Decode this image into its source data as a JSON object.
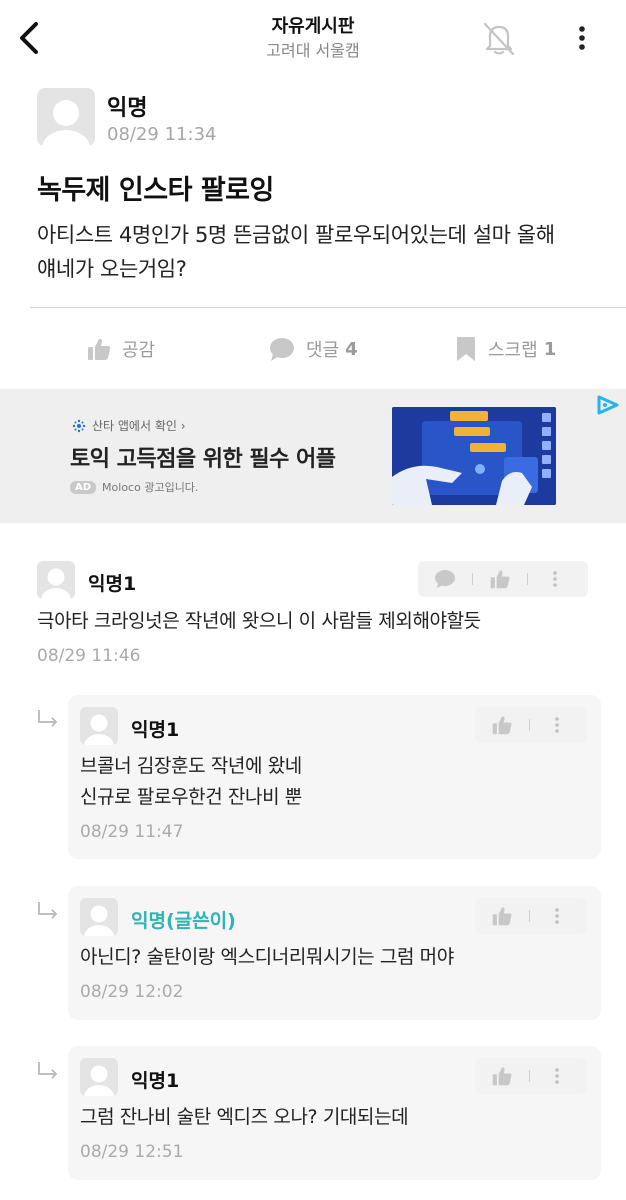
{
  "header": {
    "title": "자유게시판",
    "subtitle": "고려대 서울캠"
  },
  "post": {
    "author": "익명",
    "time": "08/29 11:34",
    "title": "녹두제 인스타 팔로잉",
    "body_line1": "아티스트 4명인가 5명 뜬금없이 팔로우되어있는데 설마 올해",
    "body_line2": "얘네가 오는거임?"
  },
  "actions": {
    "like_label": "공감",
    "comment_label": "댓글",
    "comment_count": "4",
    "scrap_label": "스크랩",
    "scrap_count": "1"
  },
  "ad": {
    "source": "산타 앱에서 확인 ›",
    "headline": "토익 고득점을 위한 필수 어플",
    "badge": "AD",
    "label": "Moloco 광고입니다."
  },
  "comments": [
    {
      "author": "익명1",
      "line1": "극아타 크라잉넛은 작년에 왓으니 이 사람들 제외해야할듯",
      "time": "08/29 11:46"
    }
  ],
  "replies": [
    {
      "author": "익명1",
      "line1": "브콜너 김장훈도 작년에 왔네",
      "line2": "신규로 팔로우한건 잔나비 뿐",
      "time": "08/29 11:47"
    },
    {
      "author": "익명(글쓴이)",
      "line1": "아닌디? 술탄이랑 엑스디너리뭐시기는 그럼 머야",
      "time": "08/29 12:02"
    },
    {
      "author": "익명1",
      "line1": "그럼 잔나비 술탄 엑디즈 오나? 기대되는데",
      "time": "08/29 12:51"
    }
  ],
  "colors": {
    "op_name": "#2fb3b3",
    "muted": "#9a9a9a",
    "ad_bg": "#efefef"
  },
  "icons": [
    "back-arrow-icon",
    "bell-off-icon",
    "more-vertical-icon",
    "thumbs-up-icon",
    "speech-bubble-icon",
    "bookmark-icon",
    "reply-arrow-icon",
    "ad-choices-icon"
  ]
}
